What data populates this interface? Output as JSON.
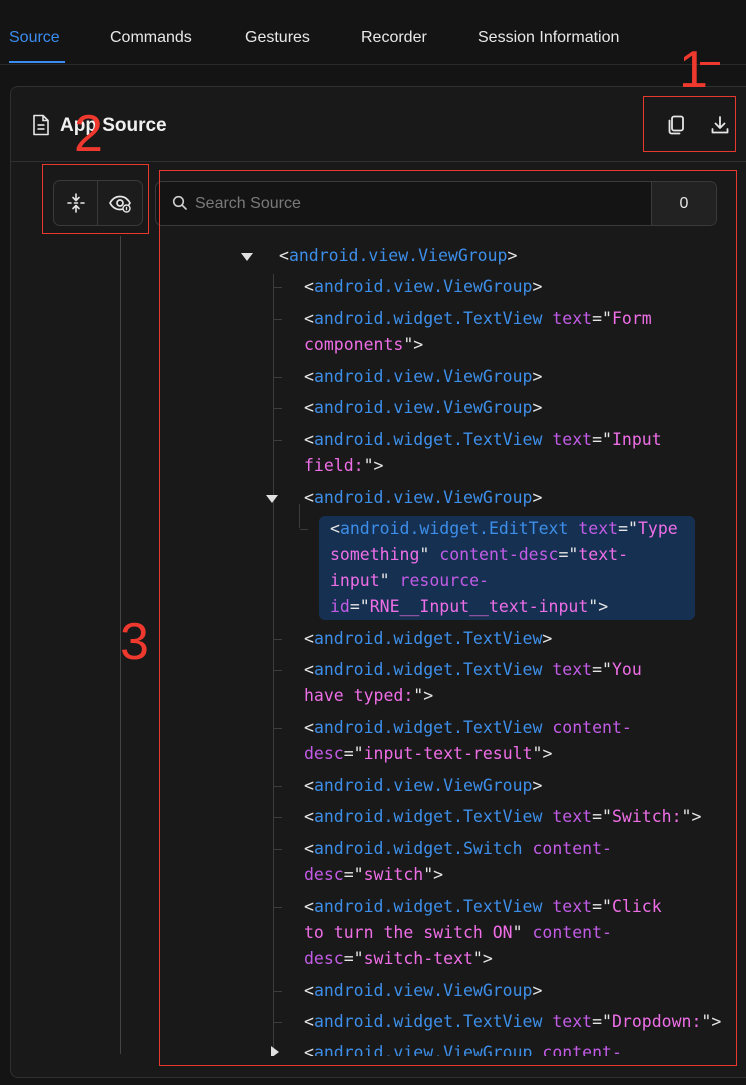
{
  "tabs": [
    {
      "label": "Source",
      "active": true
    },
    {
      "label": "Commands",
      "active": false
    },
    {
      "label": "Gestures",
      "active": false
    },
    {
      "label": "Recorder",
      "active": false
    },
    {
      "label": "Session Information",
      "active": false
    }
  ],
  "panel": {
    "title": "App Source",
    "icon": "document-icon",
    "actions": [
      {
        "name": "copy-xml-button",
        "icon": "copy-icon"
      },
      {
        "name": "download-xml-button",
        "icon": "download-icon"
      }
    ]
  },
  "tools": [
    {
      "name": "collapse-all-button",
      "icon": "collapse-icon"
    },
    {
      "name": "toggle-attributes-button",
      "icon": "eye-icon"
    }
  ],
  "search": {
    "placeholder": "Search Source",
    "value": "",
    "count": "0"
  },
  "annotations": [
    "1",
    "2",
    "3"
  ],
  "colors": {
    "accent": "#3b8cf0",
    "tag": "#3d8ee8",
    "attr": "#c25ce6",
    "value": "#ee6ee6",
    "selected": "#163052",
    "annotation": "#e8392e"
  },
  "tree": [
    {
      "lines": [
        [
          [
            "<",
            "b"
          ],
          [
            "android.view.ViewGroup",
            "t"
          ],
          [
            ">",
            "b"
          ]
        ]
      ]
    },
    {
      "lines": [
        [
          [
            "<",
            "b"
          ],
          [
            "android.view.ViewGroup",
            "t"
          ],
          [
            ">",
            "b"
          ]
        ]
      ]
    },
    {
      "lines": [
        [
          [
            "<",
            "b"
          ],
          [
            "android.widget.TextView",
            "t"
          ],
          [
            " ",
            "b"
          ],
          [
            "text",
            "a"
          ],
          [
            "=\"",
            "b"
          ],
          [
            "Form",
            "v"
          ]
        ],
        [
          [
            "components",
            "v"
          ],
          [
            "\">",
            "b"
          ]
        ]
      ]
    },
    {
      "lines": [
        [
          [
            "<",
            "b"
          ],
          [
            "android.view.ViewGroup",
            "t"
          ],
          [
            ">",
            "b"
          ]
        ]
      ]
    },
    {
      "lines": [
        [
          [
            "<",
            "b"
          ],
          [
            "android.view.ViewGroup",
            "t"
          ],
          [
            ">",
            "b"
          ]
        ]
      ]
    },
    {
      "lines": [
        [
          [
            "<",
            "b"
          ],
          [
            "android.widget.TextView",
            "t"
          ],
          [
            " ",
            "b"
          ],
          [
            "text",
            "a"
          ],
          [
            "=\"",
            "b"
          ],
          [
            "Input",
            "v"
          ]
        ],
        [
          [
            "field:",
            "v"
          ],
          [
            "\">",
            "b"
          ]
        ]
      ]
    },
    {
      "lines": [
        [
          [
            "<",
            "b"
          ],
          [
            "android.view.ViewGroup",
            "t"
          ],
          [
            ">",
            "b"
          ]
        ]
      ]
    },
    {
      "lines": [
        [
          [
            "<",
            "b"
          ],
          [
            "android.widget.EditText",
            "t"
          ],
          [
            " ",
            "b"
          ],
          [
            "text",
            "a"
          ],
          [
            "=\"",
            "b"
          ],
          [
            "Type",
            "v"
          ]
        ],
        [
          [
            "something",
            "v"
          ],
          [
            "\" ",
            "b"
          ],
          [
            "content-desc",
            "a"
          ],
          [
            "=\"",
            "b"
          ],
          [
            "text-",
            "v"
          ]
        ],
        [
          [
            "input",
            "v"
          ],
          [
            "\" ",
            "b"
          ],
          [
            "resource-",
            "a"
          ]
        ],
        [
          [
            "id",
            "a"
          ],
          [
            "=\"",
            "b"
          ],
          [
            "RNE__Input__text-input",
            "v"
          ],
          [
            "\">",
            "b"
          ]
        ]
      ]
    },
    {
      "lines": [
        [
          [
            "<",
            "b"
          ],
          [
            "android.widget.TextView",
            "t"
          ],
          [
            ">",
            "b"
          ]
        ]
      ]
    },
    {
      "lines": [
        [
          [
            "<",
            "b"
          ],
          [
            "android.widget.TextView",
            "t"
          ],
          [
            " ",
            "b"
          ],
          [
            "text",
            "a"
          ],
          [
            "=\"",
            "b"
          ],
          [
            "You",
            "v"
          ]
        ],
        [
          [
            "have typed:",
            "v"
          ],
          [
            "\">",
            "b"
          ]
        ]
      ]
    },
    {
      "lines": [
        [
          [
            "<",
            "b"
          ],
          [
            "android.widget.TextView",
            "t"
          ],
          [
            " ",
            "b"
          ],
          [
            "content-",
            "a"
          ]
        ],
        [
          [
            "desc",
            "a"
          ],
          [
            "=\"",
            "b"
          ],
          [
            "input-text-result",
            "v"
          ],
          [
            "\">",
            "b"
          ]
        ]
      ]
    },
    {
      "lines": [
        [
          [
            "<",
            "b"
          ],
          [
            "android.view.ViewGroup",
            "t"
          ],
          [
            ">",
            "b"
          ]
        ]
      ]
    },
    {
      "lines": [
        [
          [
            "<",
            "b"
          ],
          [
            "android.widget.TextView",
            "t"
          ],
          [
            " ",
            "b"
          ],
          [
            "text",
            "a"
          ],
          [
            "=\"",
            "b"
          ],
          [
            "Switch:",
            "v"
          ],
          [
            "\">",
            "b"
          ]
        ]
      ]
    },
    {
      "lines": [
        [
          [
            "<",
            "b"
          ],
          [
            "android.widget.Switch",
            "t"
          ],
          [
            " ",
            "b"
          ],
          [
            "content-",
            "a"
          ]
        ],
        [
          [
            "desc",
            "a"
          ],
          [
            "=\"",
            "b"
          ],
          [
            "switch",
            "v"
          ],
          [
            "\">",
            "b"
          ]
        ]
      ]
    },
    {
      "lines": [
        [
          [
            "<",
            "b"
          ],
          [
            "android.widget.TextView",
            "t"
          ],
          [
            " ",
            "b"
          ],
          [
            "text",
            "a"
          ],
          [
            "=\"",
            "b"
          ],
          [
            "Click",
            "v"
          ]
        ],
        [
          [
            "to turn the switch ON",
            "v"
          ],
          [
            "\" ",
            "b"
          ],
          [
            "content-",
            "a"
          ]
        ],
        [
          [
            "desc",
            "a"
          ],
          [
            "=\"",
            "b"
          ],
          [
            "switch-text",
            "v"
          ],
          [
            "\">",
            "b"
          ]
        ]
      ]
    },
    {
      "lines": [
        [
          [
            "<",
            "b"
          ],
          [
            "android.view.ViewGroup",
            "t"
          ],
          [
            ">",
            "b"
          ]
        ]
      ]
    },
    {
      "lines": [
        [
          [
            "<",
            "b"
          ],
          [
            "android.widget.TextView",
            "t"
          ],
          [
            " ",
            "b"
          ],
          [
            "text",
            "a"
          ],
          [
            "=\"",
            "b"
          ],
          [
            "Dropdown:",
            "v"
          ],
          [
            "\">",
            "b"
          ]
        ]
      ]
    },
    {
      "lines": [
        [
          [
            "<",
            "b"
          ],
          [
            "android.view.ViewGroup",
            "t"
          ],
          [
            " ",
            "b"
          ],
          [
            "content-",
            "a"
          ]
        ]
      ]
    }
  ]
}
